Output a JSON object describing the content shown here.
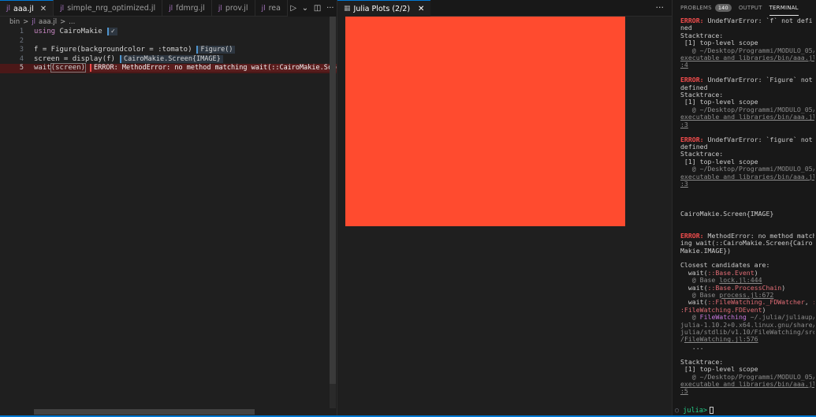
{
  "editor": {
    "tabs": [
      {
        "label": "aaa.jl",
        "active": true
      },
      {
        "label": "simple_nrg_optimized.jl",
        "active": false
      },
      {
        "label": "fdmrg.jl",
        "active": false
      },
      {
        "label": "prov.jl",
        "active": false
      },
      {
        "label": "rea",
        "active": false
      }
    ],
    "tab_glyph": "jl",
    "close_glyph": "✕",
    "actions": {
      "run": "▷",
      "run_more": "⌄",
      "split": "◫",
      "more": "···"
    },
    "breadcrumb": {
      "folder": "bin",
      "sep": ">",
      "file": "aaa.jl",
      "sep2": ">",
      "symbol": "..."
    },
    "lines": [
      {
        "num": "1",
        "keyword": "using",
        "code": " CairoMakie",
        "inline": "✓",
        "inline_type": "ok"
      },
      {
        "num": "2",
        "keyword": "",
        "code": "",
        "inline": "",
        "inline_type": ""
      },
      {
        "num": "3",
        "keyword": "",
        "code": "f = Figure(backgroundcolor = :tomato)",
        "inline": "Figure()",
        "inline_type": "ok"
      },
      {
        "num": "4",
        "keyword": "",
        "code": "screen = display(f)",
        "inline": "CairoMakie.Screen{IMAGE}",
        "inline_type": "ok"
      },
      {
        "num": "5",
        "keyword": "",
        "code_pre": "wait",
        "code_hl": "(screen)",
        "inline": "ERROR: MethodError: no method matching wait(::CairoMakie.Screen{",
        "inline_type": "error"
      }
    ]
  },
  "plot_pane": {
    "tab_label": "Julia Plots (2/2)",
    "tab_icon": "▦",
    "close_glyph": "✕",
    "more": "···",
    "figure_background": "#ff4b2f"
  },
  "panel": {
    "tabs": [
      {
        "label": "PROBLEMS",
        "badge": "140",
        "active": false
      },
      {
        "label": "OUTPUT",
        "badge": "",
        "active": false
      },
      {
        "label": "TERMINAL",
        "badge": "",
        "active": true
      }
    ],
    "prompt_marker": "○",
    "prompt": "julia>"
  },
  "colors": {
    "accent": "#0078d4",
    "error": "#f14c4c",
    "tomato": "#ff4b2f"
  }
}
